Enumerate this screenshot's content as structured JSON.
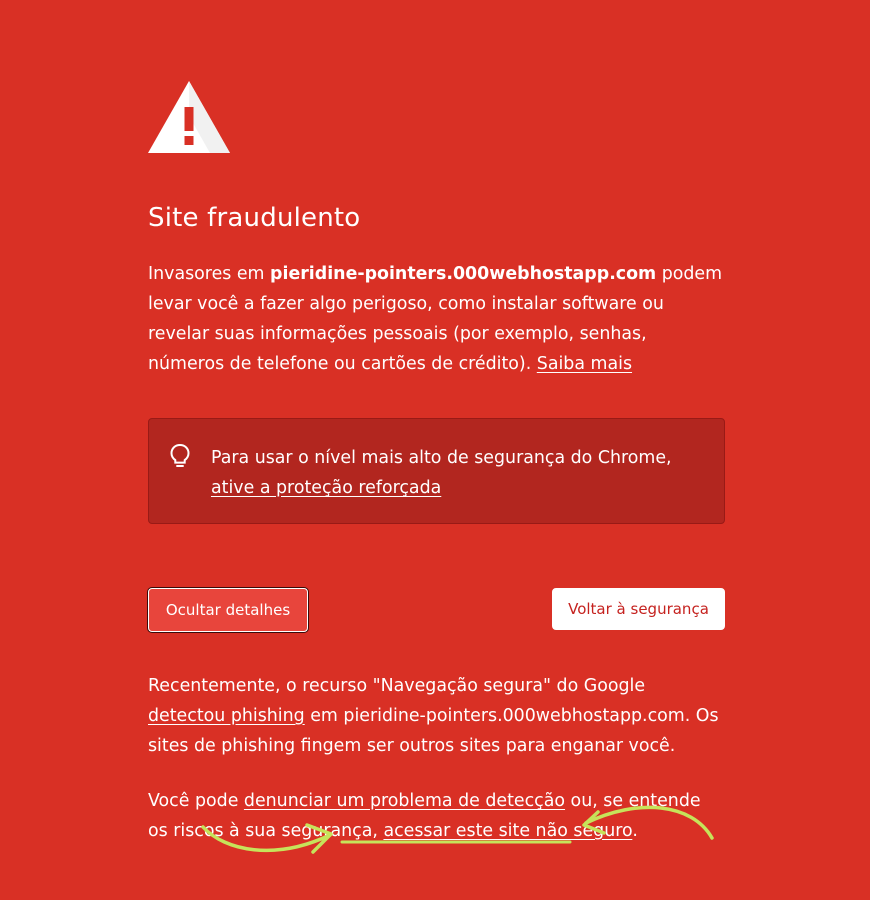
{
  "page": {
    "title": "Site fraudulento",
    "intro": {
      "prefix": "Invasores em ",
      "domain": "pieridine-pointers.000webhostapp.com",
      "suffix": " podem levar você a fazer algo perigoso, como instalar software ou revelar suas informações pessoais (por exemplo, senhas, números de telefone ou cartões de crédito). ",
      "learn_more_link": "Saiba mais"
    },
    "enhanced_protection": {
      "text": "Para usar o nível mais alto de segurança do Chrome, ",
      "link": "ative a proteção reforçada"
    },
    "buttons": {
      "hide_details": "Ocultar detalhes",
      "back_to_safety": "Voltar à segurança"
    },
    "details": {
      "paragraph1_prefix": "Recentemente, o recurso \"Navegação segura\" do Google ",
      "detected_phishing_link": "detectou phishing",
      "paragraph1_suffix": " em pieridine-pointers.000webhostapp.com. Os sites de phishing fingem ser outros sites para enganar você.",
      "paragraph2_prefix": "Você pode ",
      "report_link": "denunciar um problema de detecção",
      "paragraph2_middle": " ou, se entende os riscos à sua segurança, ",
      "visit_unsafe_link": "acessar este site não seguro",
      "paragraph2_suffix": "."
    },
    "icons": {
      "warning": "warning-triangle-icon",
      "bulb": "lightbulb-icon"
    },
    "colors": {
      "background": "#d93025",
      "box": "#b2261f",
      "annotation": "#c6e35a",
      "back_button_text": "#c5221f"
    }
  }
}
